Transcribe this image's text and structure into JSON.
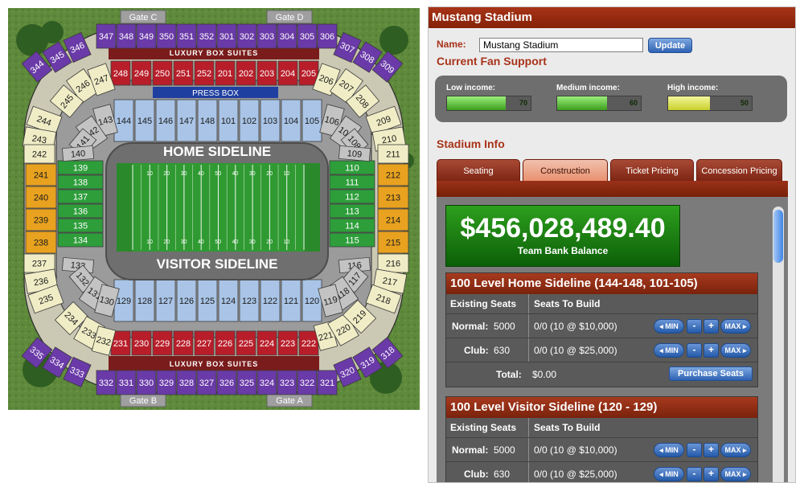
{
  "stadium_map": {
    "gates": [
      "Gate C",
      "Gate D",
      "Gate B",
      "Gate A"
    ],
    "luxury_label": "LUXURY BOX SUITES",
    "press_box": "PRESS BOX",
    "home_sideline": "HOME SIDELINE",
    "visitor_sideline": "VISITOR SIDELINE",
    "field_yard_numbers": [
      "10",
      "20",
      "30",
      "40",
      "50",
      "40",
      "30",
      "20",
      "10"
    ],
    "sections": {
      "upper_top": [
        "344",
        "345",
        "346",
        "347",
        "348",
        "349",
        "350",
        "351",
        "352",
        "301",
        "302",
        "303",
        "304",
        "305",
        "306",
        "307",
        "308",
        "309"
      ],
      "upper_bottom": [
        "335",
        "334",
        "333",
        "332",
        "331",
        "330",
        "329",
        "328",
        "327",
        "326",
        "325",
        "324",
        "323",
        "322",
        "321",
        "320",
        "319",
        "318"
      ],
      "luxury_top": [
        "248",
        "249",
        "250",
        "251",
        "252",
        "201",
        "202",
        "203",
        "204",
        "205"
      ],
      "luxury_bottom": [
        "231",
        "230",
        "229",
        "228",
        "227",
        "226",
        "225",
        "224",
        "223",
        "222"
      ],
      "home_lower": [
        "144",
        "145",
        "146",
        "147",
        "148",
        "101",
        "102",
        "103",
        "104",
        "105"
      ],
      "visitor_lower": [
        "129",
        "128",
        "127",
        "126",
        "125",
        "124",
        "123",
        "122",
        "121",
        "120"
      ],
      "left_club": [
        "139",
        "138",
        "137",
        "136",
        "135",
        "134"
      ],
      "right_club": [
        "110",
        "111",
        "112",
        "113",
        "114",
        "115"
      ],
      "left_mid_orange": [
        "241",
        "240",
        "239",
        "238"
      ],
      "right_mid_orange": [
        "212",
        "213",
        "214",
        "215"
      ],
      "left_mid_cream": [
        "244",
        "243",
        "242",
        "237",
        "236",
        "235"
      ],
      "right_mid_cream": [
        "209",
        "210",
        "211",
        "216",
        "217",
        "218"
      ],
      "corners_200": [
        "246",
        "247",
        "245",
        "206",
        "207",
        "208",
        "234",
        "233",
        "232",
        "221",
        "220",
        "219"
      ],
      "corners_100": [
        "143",
        "142",
        "141",
        "140",
        "133",
        "132",
        "131",
        "130",
        "106",
        "107",
        "108",
        "109",
        "116",
        "117",
        "118",
        "119"
      ]
    }
  },
  "panel": {
    "title": "Mustang Stadium",
    "name_label": "Name:",
    "name_value": "Mustang Stadium",
    "update_label": "Update",
    "fan_support_title": "Current Fan Support",
    "fan_support": [
      {
        "label": "Low income:",
        "value": "70",
        "level": 0.7,
        "color": "green"
      },
      {
        "label": "Medium income:",
        "value": "60",
        "level": 0.6,
        "color": "green"
      },
      {
        "label": "High income:",
        "value": "50",
        "level": 0.5,
        "color": "yellow"
      }
    ],
    "stadium_info_title": "Stadium Info",
    "tabs": [
      "Seating",
      "Construction",
      "Ticket Pricing",
      "Concession Pricing"
    ],
    "active_tab": "Construction",
    "bank_balance": "$456,028,489.40",
    "bank_caption": "Team Bank Balance",
    "levels": [
      {
        "title": "100 Level Home Sideline (144-148, 101-105)",
        "existing_header": "Existing Seats",
        "build_header": "Seats To Build",
        "rows": [
          {
            "label": "Normal:",
            "existing": "5000",
            "build": "0/0 (10 @ $10,000)"
          },
          {
            "label": "Club:",
            "existing": "630",
            "build": "0/0 (10 @ $25,000)"
          }
        ],
        "total_label": "Total:",
        "total_value": "$0.00",
        "purchase_label": "Purchase Seats"
      },
      {
        "title": "100 Level Visitor Sideline (120 - 129)",
        "existing_header": "Existing Seats",
        "build_header": "Seats To Build",
        "rows": [
          {
            "label": "Normal:",
            "existing": "5000",
            "build": "0/0 (10 @ $10,000)"
          },
          {
            "label": "Club:",
            "existing": "630",
            "build": "0/0 (10 @ $25,000)"
          }
        ]
      }
    ],
    "controls": {
      "min": "◂ MIN",
      "minus": "-",
      "plus": "+",
      "max": "MAX ▸"
    }
  }
}
